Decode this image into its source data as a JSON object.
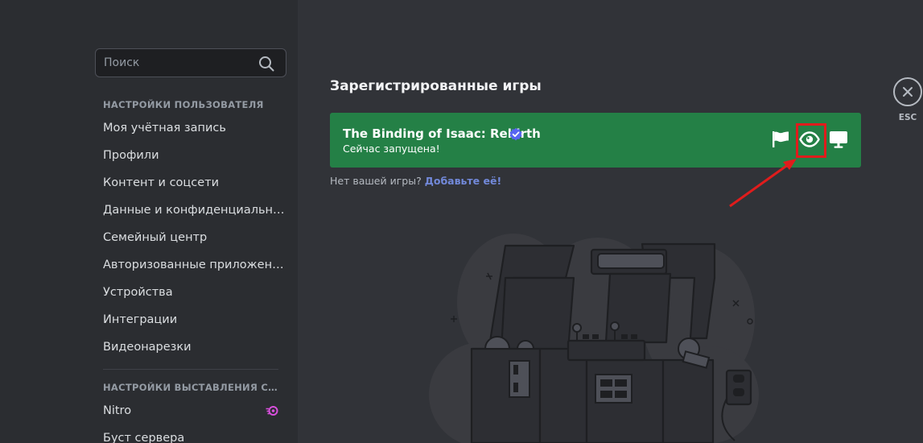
{
  "search": {
    "placeholder": "Поиск"
  },
  "sidebar": {
    "user_settings_header": "НАСТРОЙКИ ПОЛЬЗОВАТЕЛЯ",
    "user_items": [
      {
        "label": "Моя учётная запись"
      },
      {
        "label": "Профили"
      },
      {
        "label": "Контент и соцсети"
      },
      {
        "label": "Данные и конфиденциально..."
      },
      {
        "label": "Семейный центр"
      },
      {
        "label": "Авторизованные приложения"
      },
      {
        "label": "Устройства"
      },
      {
        "label": "Интеграции"
      },
      {
        "label": "Видеонарезки"
      }
    ],
    "billing_header": "НАСТРОЙКИ ВЫСТАВЛЕНИЯ СЧЕТ...",
    "billing_items": [
      {
        "label": "Nitro",
        "icon": "nitro-icon"
      },
      {
        "label": "Буст сервера"
      }
    ]
  },
  "main": {
    "title": "Зарегистрированные игры",
    "game": {
      "name": "The Binding of Isaac: Rebirth",
      "status": "Сейчас запущена!",
      "verified_icon": "verified-badge-icon",
      "icons": [
        "flag-icon",
        "eye-icon",
        "monitor-icon"
      ]
    },
    "hint_text": "Нет вашей игры?",
    "hint_link": "Добавьте её!"
  },
  "close": {
    "label": "ESC",
    "icon": "close-icon"
  },
  "colors": {
    "sidebar_bg": "#2b2d31",
    "main_bg": "#313338",
    "card_green": "#248046",
    "link": "#7289da",
    "annotation_red": "#e01c1c",
    "nitro_pink": "#d84fdc"
  }
}
